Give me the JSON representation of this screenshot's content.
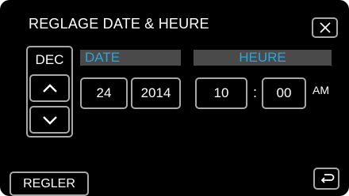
{
  "title": "REGLAGE DATE & HEURE",
  "headers": {
    "date": "DATE",
    "time": "HEURE"
  },
  "date": {
    "month": "DEC",
    "day": "24",
    "year": "2014"
  },
  "time": {
    "hour": "10",
    "separator": ":",
    "minute": "00",
    "period": "AM"
  },
  "buttons": {
    "set": "REGLER"
  },
  "icons": {
    "close": "close-icon",
    "up": "chevron-up-icon",
    "down": "chevron-down-icon",
    "back": "return-icon"
  },
  "colors": {
    "background": "#000000",
    "text": "#ffffff",
    "accent": "#2ea6d6",
    "header_bar": "#4a4a4a",
    "border": "#a8a8a8"
  }
}
